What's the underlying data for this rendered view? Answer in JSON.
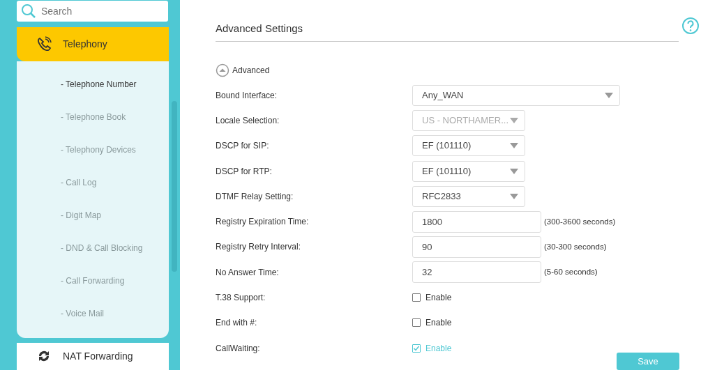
{
  "search": {
    "placeholder": "Search"
  },
  "sidebar": {
    "section": {
      "label": "Telephony",
      "expanded": true
    },
    "items": [
      {
        "label": "- Telephone Number",
        "selected": true
      },
      {
        "label": "- Telephone Book",
        "selected": false
      },
      {
        "label": "- Telephony Devices",
        "selected": false
      },
      {
        "label": "- Call Log",
        "selected": false
      },
      {
        "label": "- Digit Map",
        "selected": false
      },
      {
        "label": "- DND & Call Blocking",
        "selected": false
      },
      {
        "label": "- Call Forwarding",
        "selected": false
      },
      {
        "label": "- Voice Mail",
        "selected": false
      }
    ],
    "next_section": {
      "label": "NAT Forwarding"
    }
  },
  "title": "Advanced Settings",
  "advanced_toggle": {
    "label": "Advanced",
    "expanded": true
  },
  "fields": [
    {
      "kind": "select",
      "label": "Bound Interface:",
      "value": "Any_WAN",
      "wide": true,
      "disabled": false
    },
    {
      "kind": "select",
      "label": "Locale Selection:",
      "value": "US - NORTHAMER...",
      "wide": false,
      "disabled": true
    },
    {
      "kind": "select",
      "label": "DSCP for SIP:",
      "value": "EF (101110)",
      "wide": false,
      "disabled": false
    },
    {
      "kind": "select",
      "label": "DSCP for RTP:",
      "value": "EF (101110)",
      "wide": false,
      "disabled": false
    },
    {
      "kind": "select",
      "label": "DTMF Relay Setting:",
      "value": "RFC2833",
      "wide": false,
      "disabled": false
    },
    {
      "kind": "input",
      "label": "Registry Expiration Time:",
      "value": "1800",
      "hint": "(300-3600 seconds)"
    },
    {
      "kind": "input",
      "label": "Registry Retry Interval:",
      "value": "90",
      "hint": "(30-300 seconds)"
    },
    {
      "kind": "input",
      "label": "No Answer Time:",
      "value": "32",
      "hint": "(5-60 seconds)"
    },
    {
      "kind": "checkbox",
      "label": "T.38 Support:",
      "option": "Enable",
      "checked": false
    },
    {
      "kind": "checkbox",
      "label": "End with #:",
      "option": "Enable",
      "checked": false
    },
    {
      "kind": "checkbox",
      "label": "CallWaiting:",
      "option": "Enable",
      "checked": true
    }
  ],
  "save_button": {
    "label": "Save"
  }
}
